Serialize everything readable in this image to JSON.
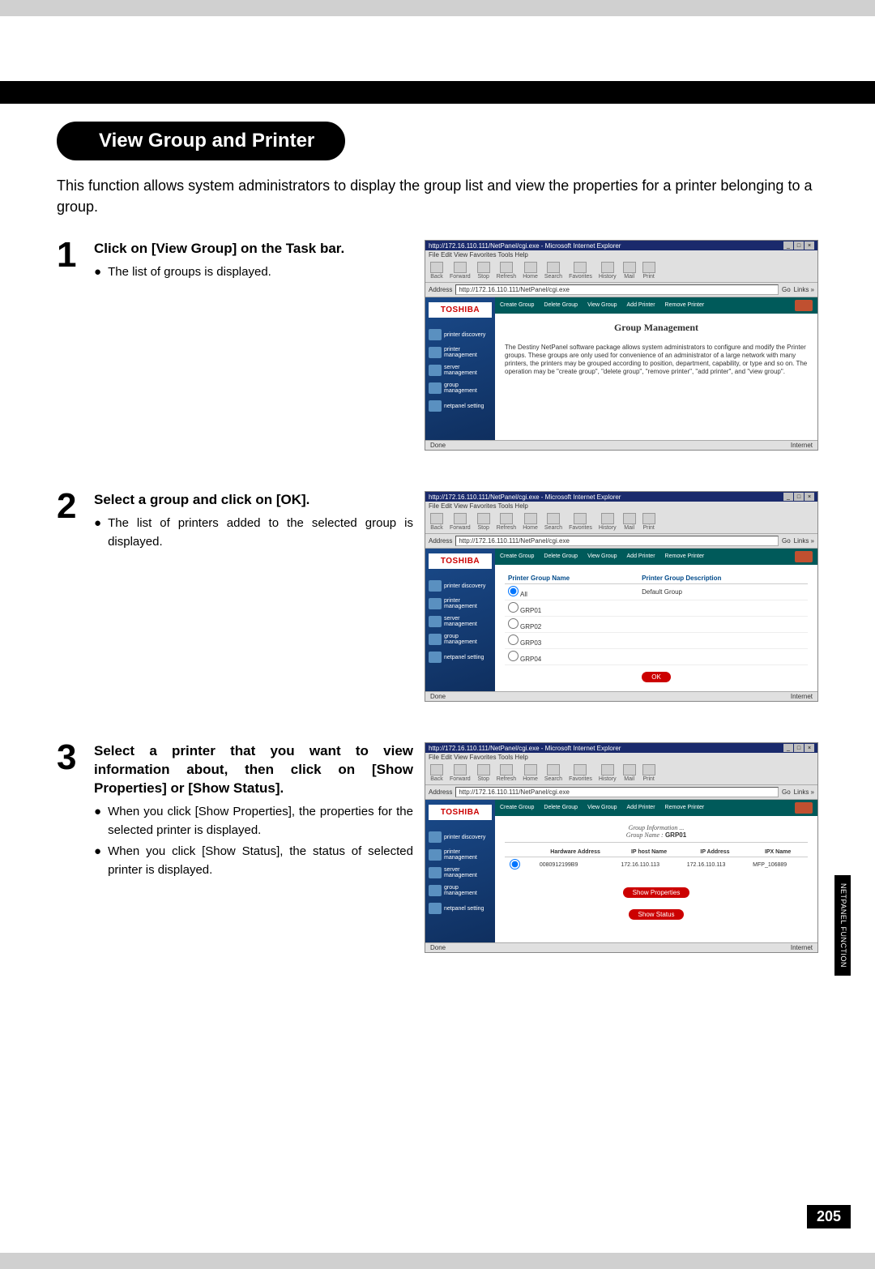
{
  "section_title": "View Group and Printer",
  "intro": "This function allows system administrators to display the group list and view the properties for a printer belonging to a group.",
  "steps": [
    {
      "num": "1",
      "heading": "Click on [View Group] on the Task bar.",
      "bullets": [
        "The list of groups is displayed."
      ]
    },
    {
      "num": "2",
      "heading": "Select a group and click on [OK].",
      "bullets": [
        "The list of printers added to the selected group is displayed."
      ]
    },
    {
      "num": "3",
      "heading": "Select a printer that you want to view information about, then click on [Show Properties] or [Show Status].",
      "bullets": [
        "When you click [Show Properties], the properties for the selected printer is displayed.",
        "When you click [Show Status], the status of selected printer is displayed."
      ]
    }
  ],
  "browser": {
    "title_prefix": "http://172.16.110.111/NetPanel/cgi.exe - Microsoft Internet Explorer",
    "menubar": "File  Edit  View  Favorites  Tools  Help",
    "toolbar": [
      "Back",
      "Forward",
      "Stop",
      "Refresh",
      "Home",
      "Search",
      "Favorites",
      "History",
      "Mail",
      "Print"
    ],
    "address_label": "Address",
    "address_url": "http://172.16.110.111/NetPanel/cgi.exe",
    "go": "Go",
    "links": "Links »",
    "status_done": "Done",
    "status_zone": "Internet"
  },
  "panel": {
    "logo": "TOSHIBA",
    "sidebar": [
      "printer discovery",
      "printer management",
      "server management",
      "group management",
      "netpanel setting"
    ],
    "tabs": [
      "Create Group",
      "Delete Group",
      "View Group",
      "Add Printer",
      "Remove Printer"
    ]
  },
  "shot1": {
    "heading": "Group Management",
    "paragraph": "The Destiny NetPanel software package allows system administrators to configure and modify the Printer groups. These groups are only used for convenience of an administrator of a large network with many printers, the printers may be grouped according to position, department, capability, or type and so on. The operation may be \"create group\", \"delete group\", \"remove printer\", \"add printer\", and \"view group\"."
  },
  "shot2": {
    "col1": "Printer Group Name",
    "col2": "Printer Group Description",
    "rows": [
      {
        "name": "All",
        "desc": "Default Group",
        "selected": true
      },
      {
        "name": "GRP01",
        "desc": "",
        "selected": false
      },
      {
        "name": "GRP02",
        "desc": "",
        "selected": false
      },
      {
        "name": "GRP03",
        "desc": "",
        "selected": false
      },
      {
        "name": "GRP04",
        "desc": "",
        "selected": false
      }
    ],
    "ok": "OK"
  },
  "shot3": {
    "group_info_label": "Group Information ...",
    "group_name_label": "Group Name :",
    "group_name": "GRP01",
    "cols": [
      "Hardware Address",
      "IP host Name",
      "IP Address",
      "IPX Name"
    ],
    "row": [
      "0080912199B9",
      "172.16.110.113",
      "172.16.110.113",
      "MFP_106889"
    ],
    "btn_props": "Show Properties",
    "btn_status": "Show Status"
  },
  "side_tab": "NETPANEL FUNCTION",
  "page_number": "205"
}
